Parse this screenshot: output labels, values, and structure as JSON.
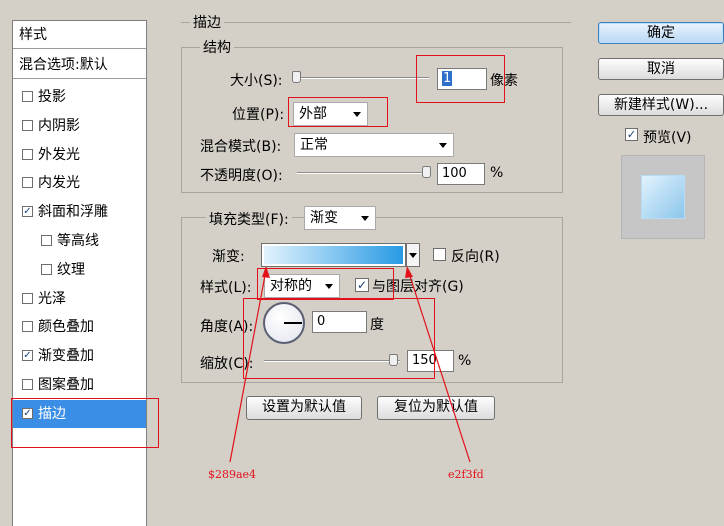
{
  "styles_panel": {
    "header": "样式",
    "blend_options": "混合选项:默认",
    "items": [
      {
        "label": "投影",
        "checked": false,
        "indent": false
      },
      {
        "label": "内阴影",
        "checked": false,
        "indent": false
      },
      {
        "label": "外发光",
        "checked": false,
        "indent": false
      },
      {
        "label": "内发光",
        "checked": false,
        "indent": false
      },
      {
        "label": "斜面和浮雕",
        "checked": true,
        "indent": false
      },
      {
        "label": "等高线",
        "checked": false,
        "indent": true
      },
      {
        "label": "纹理",
        "checked": false,
        "indent": true
      },
      {
        "label": "光泽",
        "checked": false,
        "indent": false
      },
      {
        "label": "颜色叠加",
        "checked": false,
        "indent": false
      },
      {
        "label": "渐变叠加",
        "checked": true,
        "indent": false
      },
      {
        "label": "图案叠加",
        "checked": false,
        "indent": false
      },
      {
        "label": "描边",
        "checked": true,
        "indent": false,
        "selected": true
      }
    ]
  },
  "stroke": {
    "title": "描边",
    "structure": {
      "title": "结构",
      "size_label": "大小(S):",
      "size_value": "1",
      "size_unit": "像素",
      "position_label": "位置(P):",
      "position_value": "外部",
      "blend_label": "混合模式(B):",
      "blend_value": "正常",
      "opacity_label": "不透明度(O):",
      "opacity_value": "100",
      "opacity_unit": "%"
    },
    "fill": {
      "type_label": "填充类型(F):",
      "type_value": "渐变",
      "gradient_label": "渐变:",
      "reverse_label": "反向(R)",
      "reverse_checked": false,
      "style_label": "样式(L):",
      "style_value": "对称的",
      "align_label": "与图层对齐(G)",
      "align_checked": true,
      "angle_label": "角度(A):",
      "angle_value": "0",
      "angle_unit": "度",
      "scale_label": "缩放(C):",
      "scale_value": "150",
      "scale_unit": "%"
    },
    "set_default": "设置为默认值",
    "reset_default": "复位为默认值"
  },
  "buttons": {
    "ok": "确定",
    "cancel": "取消",
    "new_style": "新建样式(W)...",
    "preview_label": "预览(V)",
    "preview_checked": true
  },
  "annotations": {
    "left_color": "$289ae4",
    "right_color": "e2f3fd"
  },
  "colors": {
    "selection": "#3a8ee6",
    "annotation_red": "#e2101a",
    "gradient_start": "#289ae4",
    "gradient_end": "#e2f3fd"
  }
}
